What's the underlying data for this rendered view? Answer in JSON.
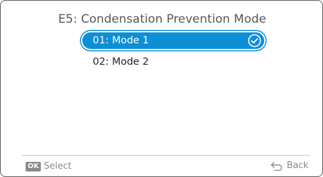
{
  "screen": {
    "title": "E5: Condensation Prevention Mode"
  },
  "options": [
    {
      "label": "01: Mode 1",
      "selected": true
    },
    {
      "label": "02: Mode 2",
      "selected": false
    }
  ],
  "footer": {
    "ok_badge": "OK",
    "select_label": "Select",
    "back_label": "Back"
  },
  "colors": {
    "accent": "#0d8fd6",
    "text": "#222222",
    "muted": "#8a8a8a"
  },
  "icons": {
    "check": "check-circle-icon",
    "back": "back-arrow-icon"
  }
}
